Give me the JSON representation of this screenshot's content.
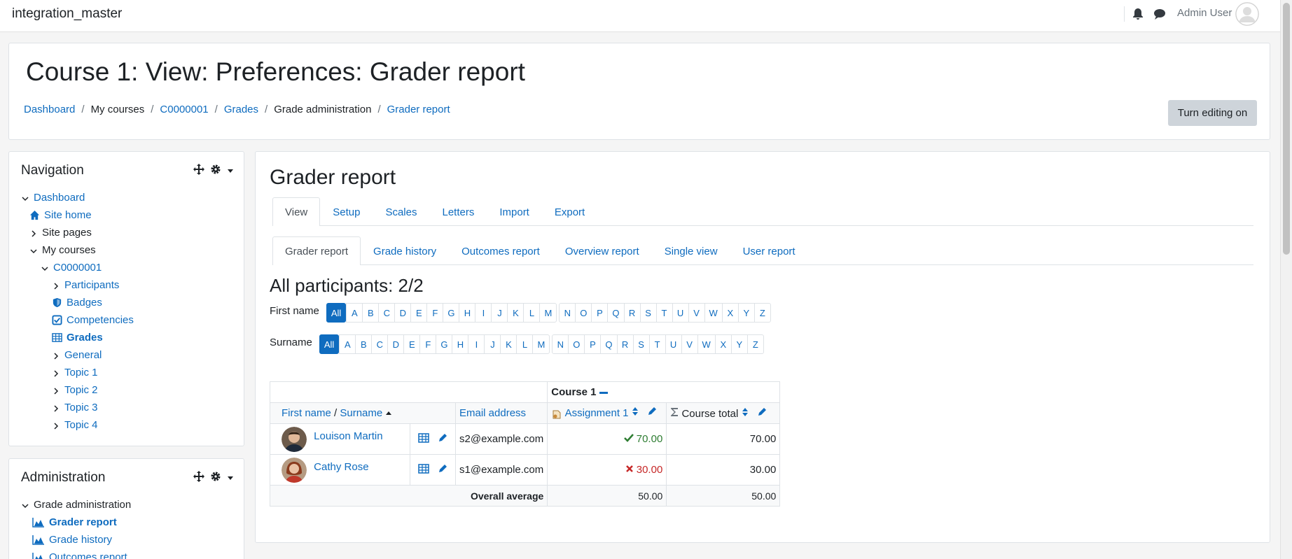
{
  "navbar": {
    "site_name": "integration_master",
    "user_name": "Admin User",
    "icons": [
      "bell-icon",
      "chat-icon",
      "avatar"
    ]
  },
  "header": {
    "title": "Course 1: View: Preferences: Grader report",
    "breadcrumb": [
      "Dashboard",
      "My courses",
      "C0000001",
      "Grades",
      "Grade administration",
      "Grader report"
    ],
    "edit_button": "Turn editing on"
  },
  "navigation": {
    "title": "Navigation",
    "items": [
      "Dashboard",
      "Site home",
      "Site pages",
      "My courses",
      "C0000001",
      "Participants",
      "Badges",
      "Competencies",
      "Grades",
      "General",
      "Topic 1",
      "Topic 2",
      "Topic 3",
      "Topic 4"
    ]
  },
  "administration": {
    "title": "Administration",
    "items": [
      "Grade administration",
      "Grader report",
      "Grade history",
      "Outcomes report"
    ]
  },
  "main": {
    "title": "Grader report",
    "tabs_top": [
      "View",
      "Setup",
      "Scales",
      "Letters",
      "Import",
      "Export"
    ],
    "tabs_sub": [
      "Grader report",
      "Grade history",
      "Outcomes report",
      "Overview report",
      "Single view",
      "User report"
    ],
    "participants": "All participants: 2/2",
    "firstname_label": "First name",
    "surname_label": "Surname",
    "all_label": "All",
    "letters": [
      "A",
      "B",
      "C",
      "D",
      "E",
      "F",
      "G",
      "H",
      "I",
      "J",
      "K",
      "L",
      "M",
      "N",
      "O",
      "P",
      "Q",
      "R",
      "S",
      "T",
      "U",
      "V",
      "W",
      "X",
      "Y",
      "Z"
    ]
  },
  "grader": {
    "course_header": "Course 1",
    "col_firstname": "First name",
    "col_slash": "/",
    "col_surname": "Surname",
    "col_email": "Email address",
    "col_assignment": "Assignment 1",
    "col_total": "Course total",
    "rows": [
      {
        "name": "Louison Martin",
        "email": "s2@example.com",
        "assignment": "70.00",
        "total": "70.00"
      },
      {
        "name": "Cathy Rose",
        "email": "s1@example.com",
        "assignment": "30.00",
        "total": "30.00"
      }
    ],
    "overall_label": "Overall average",
    "overall_assignment": "50.00",
    "overall_total": "50.00"
  },
  "colors": {
    "link": "#0f6cbf",
    "pass": "#2e7d32",
    "fail": "#c62828"
  }
}
